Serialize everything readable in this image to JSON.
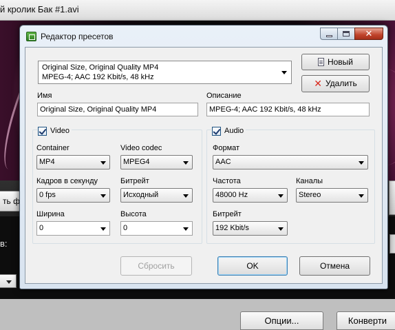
{
  "background_app": {
    "title": "й кролик Бак #1.avi",
    "left_button_text": "ть фа",
    "left_label": "в:",
    "options_button": "Опции...",
    "convert_button": "Конверти"
  },
  "dialog": {
    "title": "Редактор пресетов",
    "preset": {
      "line1": "Original Size, Original Quality MP4",
      "line2": "MPEG-4; AAC 192 Kbit/s, 48 kHz"
    },
    "new_button": "Новый",
    "delete_button": "Удалить",
    "name_label": "Имя",
    "name_value": "Original Size, Original Quality MP4",
    "description_label": "Описание",
    "description_value": "MPEG-4; AAC 192 Kbit/s, 48 kHz",
    "video": {
      "label": "Video",
      "checked": true,
      "container_label": "Container",
      "container_value": "MP4",
      "codec_label": "Video codec",
      "codec_value": "MPEG4",
      "fps_label": "Кадров в секунду",
      "fps_value": "0 fps",
      "bitrate_label": "Битрейт",
      "bitrate_value": "Исходный",
      "width_label": "Ширина",
      "width_value": "0",
      "height_label": "Высота",
      "height_value": "0"
    },
    "audio": {
      "label": "Audio",
      "checked": true,
      "format_label": "Формат",
      "format_value": "AAC",
      "frequency_label": "Частота",
      "frequency_value": "48000 Hz",
      "channels_label": "Каналы",
      "channels_value": "Stereo",
      "bitrate_label": "Битрейт",
      "bitrate_value": "192 Kbit/s"
    },
    "reset_button": "Сбросить",
    "ok_button": "OK",
    "cancel_button": "Отмена"
  },
  "colors": {
    "accent_close": "#c0432b",
    "dialog_frame": "#d8e3ef",
    "default_button_border": "#3c7fb1"
  }
}
